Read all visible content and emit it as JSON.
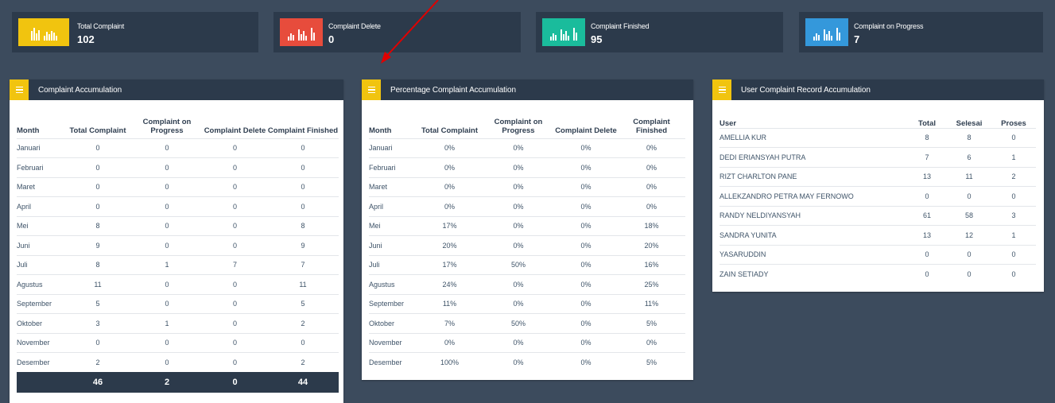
{
  "stats": [
    {
      "title": "Total Complaint",
      "value": "102",
      "color": "#f1c40f"
    },
    {
      "title": "Complaint Delete",
      "value": "0",
      "color": "#e74c3c"
    },
    {
      "title": "Complaint Finished",
      "value": "95",
      "color": "#1abc9c"
    },
    {
      "title": "Complaint on Progress",
      "value": "7",
      "color": "#3498db"
    }
  ],
  "accumulation": {
    "title": "Complaint Accumulation",
    "headers": [
      "Month",
      "Total Complaint",
      "Complaint on Progress",
      "Complaint Delete",
      "Complaint Finished"
    ],
    "rows": [
      [
        "Januari",
        "0",
        "0",
        "0",
        "0"
      ],
      [
        "Februari",
        "0",
        "0",
        "0",
        "0"
      ],
      [
        "Maret",
        "0",
        "0",
        "0",
        "0"
      ],
      [
        "April",
        "0",
        "0",
        "0",
        "0"
      ],
      [
        "Mei",
        "8",
        "0",
        "0",
        "8"
      ],
      [
        "Juni",
        "9",
        "0",
        "0",
        "9"
      ],
      [
        "Juli",
        "8",
        "1",
        "7",
        "7"
      ],
      [
        "Agustus",
        "11",
        "0",
        "0",
        "11"
      ],
      [
        "September",
        "5",
        "0",
        "0",
        "5"
      ],
      [
        "Oktober",
        "3",
        "1",
        "0",
        "2"
      ],
      [
        "November",
        "0",
        "0",
        "0",
        "0"
      ],
      [
        "Desember",
        "2",
        "0",
        "0",
        "2"
      ]
    ],
    "totals": [
      "46",
      "2",
      "0",
      "44"
    ]
  },
  "percentage": {
    "title": "Percentage Complaint Accumulation",
    "headers": [
      "Month",
      "Total Complaint",
      "Complaint on Progress",
      "Complaint Delete",
      "Complaint Finished"
    ],
    "rows": [
      [
        "Januari",
        "0%",
        "0%",
        "0%",
        "0%"
      ],
      [
        "Februari",
        "0%",
        "0%",
        "0%",
        "0%"
      ],
      [
        "Maret",
        "0%",
        "0%",
        "0%",
        "0%"
      ],
      [
        "April",
        "0%",
        "0%",
        "0%",
        "0%"
      ],
      [
        "Mei",
        "17%",
        "0%",
        "0%",
        "18%"
      ],
      [
        "Juni",
        "20%",
        "0%",
        "0%",
        "20%"
      ],
      [
        "Juli",
        "17%",
        "50%",
        "0%",
        "16%"
      ],
      [
        "Agustus",
        "24%",
        "0%",
        "0%",
        "25%"
      ],
      [
        "September",
        "11%",
        "0%",
        "0%",
        "11%"
      ],
      [
        "Oktober",
        "7%",
        "50%",
        "0%",
        "5%"
      ],
      [
        "November",
        "0%",
        "0%",
        "0%",
        "0%"
      ],
      [
        "Desember",
        "100%",
        "0%",
        "0%",
        "5%"
      ]
    ]
  },
  "users": {
    "title": "User Complaint Record Accumulation",
    "headers": [
      "User",
      "Total",
      "Selesai",
      "Proses"
    ],
    "rows": [
      [
        "AMELLIA KUR",
        "8",
        "8",
        "0"
      ],
      [
        "DEDI ERIANSYAH PUTRA",
        "7",
        "6",
        "1"
      ],
      [
        "RIZT CHARLTON PANE",
        "13",
        "11",
        "2"
      ],
      [
        "ALLEKZANDRO PETRA MAY FERNOWO",
        "0",
        "0",
        "0"
      ],
      [
        "RANDY NELDIYANSYAH",
        "61",
        "58",
        "3"
      ],
      [
        "SANDRA YUNITA",
        "13",
        "12",
        "1"
      ],
      [
        "YASARUDDIN",
        "0",
        "0",
        "0"
      ],
      [
        "ZAIN SETIADY",
        "0",
        "0",
        "0"
      ]
    ]
  },
  "colors": {
    "background": "#3c4b5d",
    "header": "#2c3a4b",
    "accent": "#f1c40f",
    "arrow": "#e00000"
  },
  "icons": {
    "stat": "bar-chart-icon",
    "panel": "menu-icon",
    "annotation": "red-arrow-icon"
  }
}
